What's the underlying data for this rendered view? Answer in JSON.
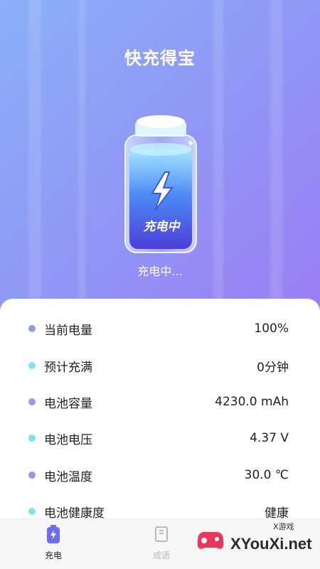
{
  "app": {
    "title": "快充得宝",
    "status": "充电中..."
  },
  "battery": {
    "label": "充电中"
  },
  "stats": [
    {
      "label": "当前电量",
      "value": "100%"
    },
    {
      "label": "预计充满",
      "value": "0分钟"
    },
    {
      "label": "电池容量",
      "value": "4230.0 mAh"
    },
    {
      "label": "电池电压",
      "value": "4.37 V"
    },
    {
      "label": "电池温度",
      "value": "30.0 ℃"
    },
    {
      "label": "电池健康度",
      "value": "健康"
    }
  ],
  "tabs": [
    {
      "label": "充电",
      "active": true
    },
    {
      "label": "成语",
      "active": false
    }
  ],
  "watermark": {
    "text": "XYouXi.net",
    "small": "X游戏"
  },
  "colors": {
    "dot_a": "#8d9cf0",
    "dot_b": "#7fe3f2",
    "active_tab": "#6b6ef0",
    "inactive_tab": "#b9b9bd"
  }
}
